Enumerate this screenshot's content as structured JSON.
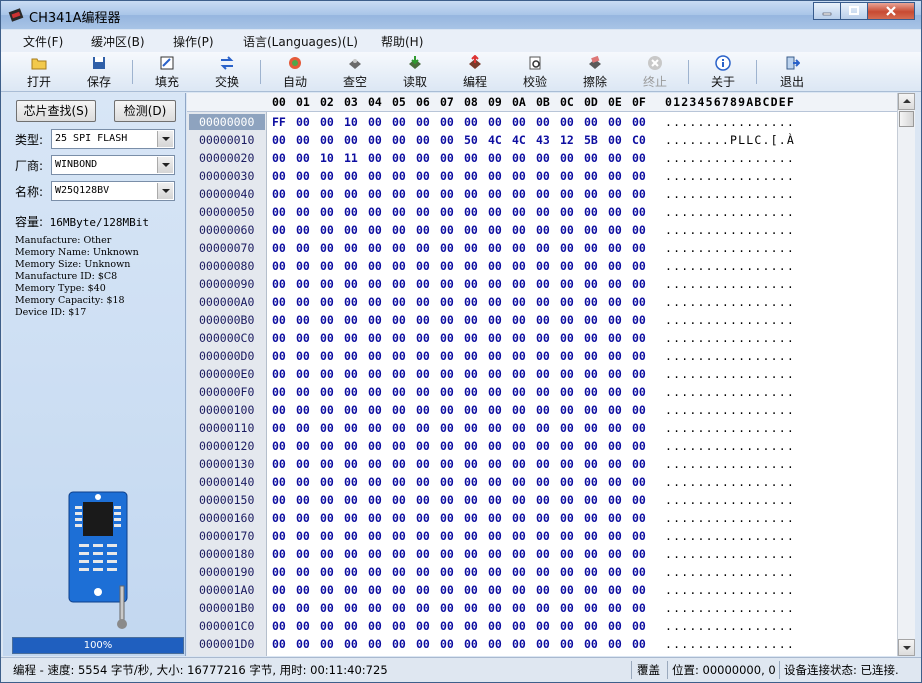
{
  "window": {
    "title": "CH341A编程器"
  },
  "menu": [
    {
      "label": "文件(F)"
    },
    {
      "label": "缓冲区(B)"
    },
    {
      "label": "操作(P)"
    },
    {
      "label": "语言(Languages)(L)"
    },
    {
      "label": "帮助(H)"
    }
  ],
  "toolbar": [
    {
      "label": "打开",
      "icon": "folder-open-icon"
    },
    {
      "label": "保存",
      "icon": "save-icon"
    },
    {
      "label": "填充",
      "icon": "fill-icon"
    },
    {
      "label": "交换",
      "icon": "swap-icon"
    },
    {
      "label": "自动",
      "icon": "auto-icon"
    },
    {
      "label": "查空",
      "icon": "blank-check-icon"
    },
    {
      "label": "读取",
      "icon": "read-icon"
    },
    {
      "label": "编程",
      "icon": "program-icon"
    },
    {
      "label": "校验",
      "icon": "verify-icon"
    },
    {
      "label": "擦除",
      "icon": "erase-icon"
    },
    {
      "label": "终止",
      "icon": "stop-icon",
      "disabled": true
    },
    {
      "label": "关于",
      "icon": "info-icon"
    },
    {
      "label": "退出",
      "icon": "exit-icon"
    }
  ],
  "left": {
    "detect_label": "芯片查找(S)",
    "check_label": "检测(D)",
    "type_label": "类型:",
    "type_value": "25 SPI FLASH",
    "vendor_label": "厂商:",
    "vendor_value": "WINBOND",
    "name_label": "名称:",
    "name_value": "W25Q128BV",
    "capacity_label": "容量:",
    "capacity_value": "16MByte/128MBit",
    "info": [
      "Manufacture: Other",
      "Memory Name: Unknown",
      "Memory Size: Unknown",
      "Manufacture ID: $C8",
      "Memory Type: $40",
      "Memory Capacity: $18",
      "Device ID: $17"
    ],
    "progress_text": "100%",
    "progress_value": 100
  },
  "hex": {
    "columns": [
      "00",
      "01",
      "02",
      "03",
      "04",
      "05",
      "06",
      "07",
      "08",
      "09",
      "0A",
      "0B",
      "0C",
      "0D",
      "0E",
      "0F"
    ],
    "ascii_header": "0123456789ABCDEF",
    "rows": [
      {
        "addr": "00000000",
        "bytes": [
          "FF",
          "00",
          "00",
          "10",
          "00",
          "00",
          "00",
          "00",
          "00",
          "00",
          "00",
          "00",
          "00",
          "00",
          "00",
          "00"
        ],
        "ascii": "................"
      },
      {
        "addr": "00000010",
        "bytes": [
          "00",
          "00",
          "00",
          "00",
          "00",
          "00",
          "00",
          "00",
          "50",
          "4C",
          "4C",
          "43",
          "12",
          "5B",
          "00",
          "C0"
        ],
        "ascii": "........PLLC.[.À"
      },
      {
        "addr": "00000020",
        "bytes": [
          "00",
          "00",
          "10",
          "11",
          "00",
          "00",
          "00",
          "00",
          "00",
          "00",
          "00",
          "00",
          "00",
          "00",
          "00",
          "00"
        ],
        "ascii": "................"
      },
      {
        "addr": "00000030",
        "bytes": [
          "00",
          "00",
          "00",
          "00",
          "00",
          "00",
          "00",
          "00",
          "00",
          "00",
          "00",
          "00",
          "00",
          "00",
          "00",
          "00"
        ],
        "ascii": "................"
      },
      {
        "addr": "00000040",
        "bytes": [
          "00",
          "00",
          "00",
          "00",
          "00",
          "00",
          "00",
          "00",
          "00",
          "00",
          "00",
          "00",
          "00",
          "00",
          "00",
          "00"
        ],
        "ascii": "................"
      },
      {
        "addr": "00000050",
        "bytes": [
          "00",
          "00",
          "00",
          "00",
          "00",
          "00",
          "00",
          "00",
          "00",
          "00",
          "00",
          "00",
          "00",
          "00",
          "00",
          "00"
        ],
        "ascii": "................"
      },
      {
        "addr": "00000060",
        "bytes": [
          "00",
          "00",
          "00",
          "00",
          "00",
          "00",
          "00",
          "00",
          "00",
          "00",
          "00",
          "00",
          "00",
          "00",
          "00",
          "00"
        ],
        "ascii": "................"
      },
      {
        "addr": "00000070",
        "bytes": [
          "00",
          "00",
          "00",
          "00",
          "00",
          "00",
          "00",
          "00",
          "00",
          "00",
          "00",
          "00",
          "00",
          "00",
          "00",
          "00"
        ],
        "ascii": "................"
      },
      {
        "addr": "00000080",
        "bytes": [
          "00",
          "00",
          "00",
          "00",
          "00",
          "00",
          "00",
          "00",
          "00",
          "00",
          "00",
          "00",
          "00",
          "00",
          "00",
          "00"
        ],
        "ascii": "................"
      },
      {
        "addr": "00000090",
        "bytes": [
          "00",
          "00",
          "00",
          "00",
          "00",
          "00",
          "00",
          "00",
          "00",
          "00",
          "00",
          "00",
          "00",
          "00",
          "00",
          "00"
        ],
        "ascii": "................"
      },
      {
        "addr": "000000A0",
        "bytes": [
          "00",
          "00",
          "00",
          "00",
          "00",
          "00",
          "00",
          "00",
          "00",
          "00",
          "00",
          "00",
          "00",
          "00",
          "00",
          "00"
        ],
        "ascii": "................"
      },
      {
        "addr": "000000B0",
        "bytes": [
          "00",
          "00",
          "00",
          "00",
          "00",
          "00",
          "00",
          "00",
          "00",
          "00",
          "00",
          "00",
          "00",
          "00",
          "00",
          "00"
        ],
        "ascii": "................"
      },
      {
        "addr": "000000C0",
        "bytes": [
          "00",
          "00",
          "00",
          "00",
          "00",
          "00",
          "00",
          "00",
          "00",
          "00",
          "00",
          "00",
          "00",
          "00",
          "00",
          "00"
        ],
        "ascii": "................"
      },
      {
        "addr": "000000D0",
        "bytes": [
          "00",
          "00",
          "00",
          "00",
          "00",
          "00",
          "00",
          "00",
          "00",
          "00",
          "00",
          "00",
          "00",
          "00",
          "00",
          "00"
        ],
        "ascii": "................"
      },
      {
        "addr": "000000E0",
        "bytes": [
          "00",
          "00",
          "00",
          "00",
          "00",
          "00",
          "00",
          "00",
          "00",
          "00",
          "00",
          "00",
          "00",
          "00",
          "00",
          "00"
        ],
        "ascii": "................"
      },
      {
        "addr": "000000F0",
        "bytes": [
          "00",
          "00",
          "00",
          "00",
          "00",
          "00",
          "00",
          "00",
          "00",
          "00",
          "00",
          "00",
          "00",
          "00",
          "00",
          "00"
        ],
        "ascii": "................"
      },
      {
        "addr": "00000100",
        "bytes": [
          "00",
          "00",
          "00",
          "00",
          "00",
          "00",
          "00",
          "00",
          "00",
          "00",
          "00",
          "00",
          "00",
          "00",
          "00",
          "00"
        ],
        "ascii": "................"
      },
      {
        "addr": "00000110",
        "bytes": [
          "00",
          "00",
          "00",
          "00",
          "00",
          "00",
          "00",
          "00",
          "00",
          "00",
          "00",
          "00",
          "00",
          "00",
          "00",
          "00"
        ],
        "ascii": "................"
      },
      {
        "addr": "00000120",
        "bytes": [
          "00",
          "00",
          "00",
          "00",
          "00",
          "00",
          "00",
          "00",
          "00",
          "00",
          "00",
          "00",
          "00",
          "00",
          "00",
          "00"
        ],
        "ascii": "................"
      },
      {
        "addr": "00000130",
        "bytes": [
          "00",
          "00",
          "00",
          "00",
          "00",
          "00",
          "00",
          "00",
          "00",
          "00",
          "00",
          "00",
          "00",
          "00",
          "00",
          "00"
        ],
        "ascii": "................"
      },
      {
        "addr": "00000140",
        "bytes": [
          "00",
          "00",
          "00",
          "00",
          "00",
          "00",
          "00",
          "00",
          "00",
          "00",
          "00",
          "00",
          "00",
          "00",
          "00",
          "00"
        ],
        "ascii": "................"
      },
      {
        "addr": "00000150",
        "bytes": [
          "00",
          "00",
          "00",
          "00",
          "00",
          "00",
          "00",
          "00",
          "00",
          "00",
          "00",
          "00",
          "00",
          "00",
          "00",
          "00"
        ],
        "ascii": "................"
      },
      {
        "addr": "00000160",
        "bytes": [
          "00",
          "00",
          "00",
          "00",
          "00",
          "00",
          "00",
          "00",
          "00",
          "00",
          "00",
          "00",
          "00",
          "00",
          "00",
          "00"
        ],
        "ascii": "................"
      },
      {
        "addr": "00000170",
        "bytes": [
          "00",
          "00",
          "00",
          "00",
          "00",
          "00",
          "00",
          "00",
          "00",
          "00",
          "00",
          "00",
          "00",
          "00",
          "00",
          "00"
        ],
        "ascii": "................"
      },
      {
        "addr": "00000180",
        "bytes": [
          "00",
          "00",
          "00",
          "00",
          "00",
          "00",
          "00",
          "00",
          "00",
          "00",
          "00",
          "00",
          "00",
          "00",
          "00",
          "00"
        ],
        "ascii": "................"
      },
      {
        "addr": "00000190",
        "bytes": [
          "00",
          "00",
          "00",
          "00",
          "00",
          "00",
          "00",
          "00",
          "00",
          "00",
          "00",
          "00",
          "00",
          "00",
          "00",
          "00"
        ],
        "ascii": "................"
      },
      {
        "addr": "000001A0",
        "bytes": [
          "00",
          "00",
          "00",
          "00",
          "00",
          "00",
          "00",
          "00",
          "00",
          "00",
          "00",
          "00",
          "00",
          "00",
          "00",
          "00"
        ],
        "ascii": "................"
      },
      {
        "addr": "000001B0",
        "bytes": [
          "00",
          "00",
          "00",
          "00",
          "00",
          "00",
          "00",
          "00",
          "00",
          "00",
          "00",
          "00",
          "00",
          "00",
          "00",
          "00"
        ],
        "ascii": "................"
      },
      {
        "addr": "000001C0",
        "bytes": [
          "00",
          "00",
          "00",
          "00",
          "00",
          "00",
          "00",
          "00",
          "00",
          "00",
          "00",
          "00",
          "00",
          "00",
          "00",
          "00"
        ],
        "ascii": "................"
      },
      {
        "addr": "000001D0",
        "bytes": [
          "00",
          "00",
          "00",
          "00",
          "00",
          "00",
          "00",
          "00",
          "00",
          "00",
          "00",
          "00",
          "00",
          "00",
          "00",
          "00"
        ],
        "ascii": "................"
      }
    ]
  },
  "status": {
    "speed_text": "编程 - 速度: 5554 字节/秒, 大小: 16777216 字节, 用时: 00:11:40:725",
    "mode_text": "覆盖",
    "position_text": "位置: 00000000, 0",
    "device_text": "设备连接状态: 已连接."
  }
}
